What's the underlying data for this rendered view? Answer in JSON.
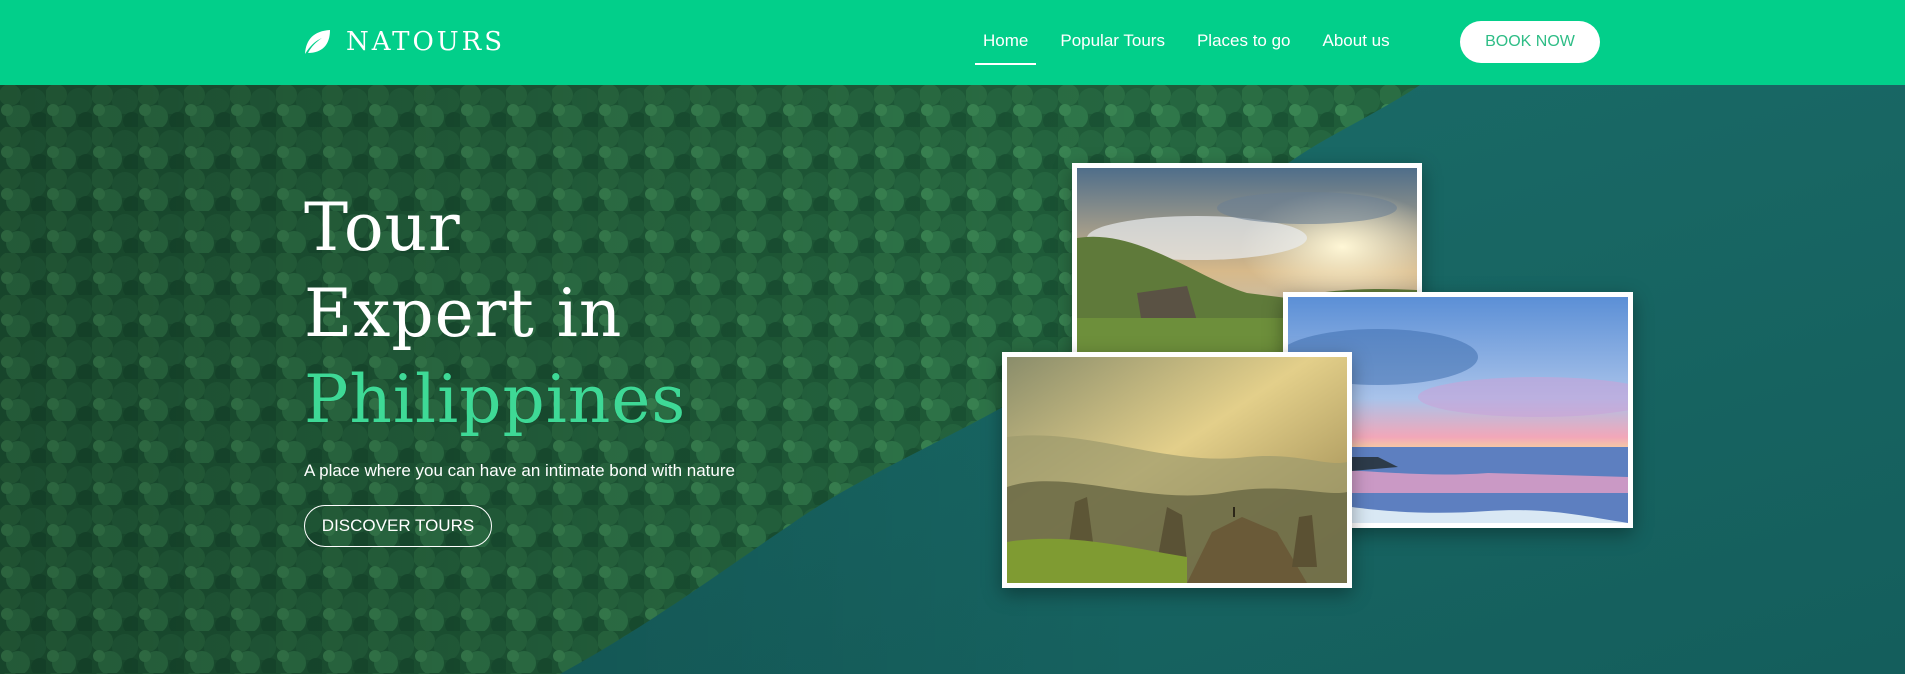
{
  "brand": {
    "name": "NATOURS",
    "icon": "leaf-icon",
    "color": "#02cf8a",
    "accent": "#3ed996"
  },
  "nav": {
    "items": [
      {
        "label": "Home",
        "active": true
      },
      {
        "label": "Popular Tours",
        "active": false
      },
      {
        "label": "Places to go",
        "active": false
      },
      {
        "label": "About us",
        "active": false
      }
    ],
    "cta": "BOOK NOW"
  },
  "hero": {
    "headline_line1": "Tour",
    "headline_line2": "Expert in",
    "headline_line3": "Philippines",
    "tagline": "A place where you can have an intimate bond with nature",
    "cta": "DISCOVER TOURS"
  }
}
